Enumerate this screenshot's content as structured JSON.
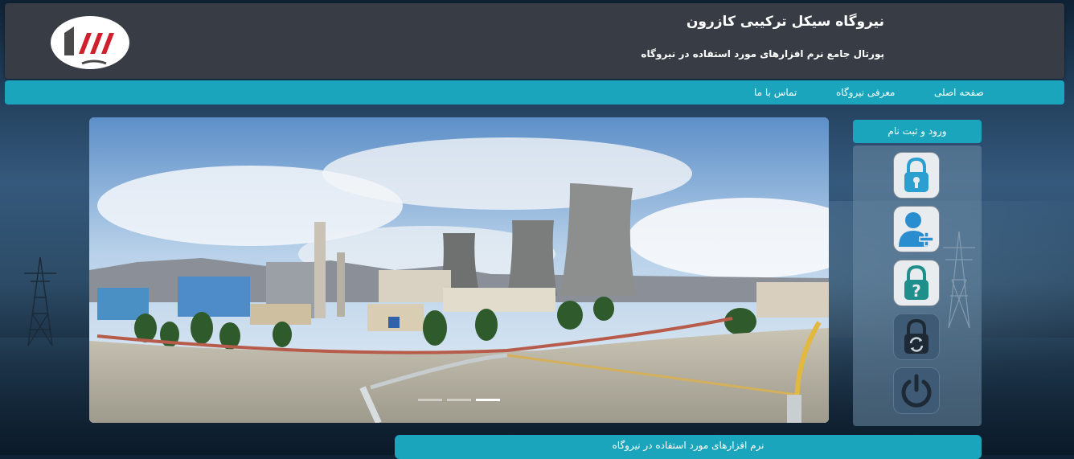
{
  "header": {
    "title": "نیروگاه سیکل ترکیبی کازرون",
    "subtitle": "پورتال جامع نرم افزارهای مورد استفاده در نیروگاه",
    "logo_icon": "mapna-logo-icon",
    "logo_colors": {
      "red": "#d0202e",
      "dark": "#4a4a4a"
    }
  },
  "nav": {
    "items": [
      {
        "label": "صفحه اصلی"
      },
      {
        "label": "معرفی نیروگاه"
      },
      {
        "label": "تماس با ما"
      }
    ]
  },
  "slider": {
    "image_icon": "power-plant-panorama-image",
    "slide_count": 3,
    "active_slide": 3
  },
  "login": {
    "title": "ورود و ثبت نام",
    "buttons": [
      {
        "icon": "lock-icon"
      },
      {
        "icon": "add-user-icon"
      },
      {
        "icon": "forgot-password-icon"
      },
      {
        "icon": "change-password-icon"
      },
      {
        "icon": "power-icon"
      }
    ]
  },
  "footer": {
    "label": "نرم افزارهای مورد استفاده در نیروگاه"
  },
  "colors": {
    "accent": "#1ba5bd",
    "header_bg": "#383d45",
    "icon_teal": "#1e8f8a"
  }
}
